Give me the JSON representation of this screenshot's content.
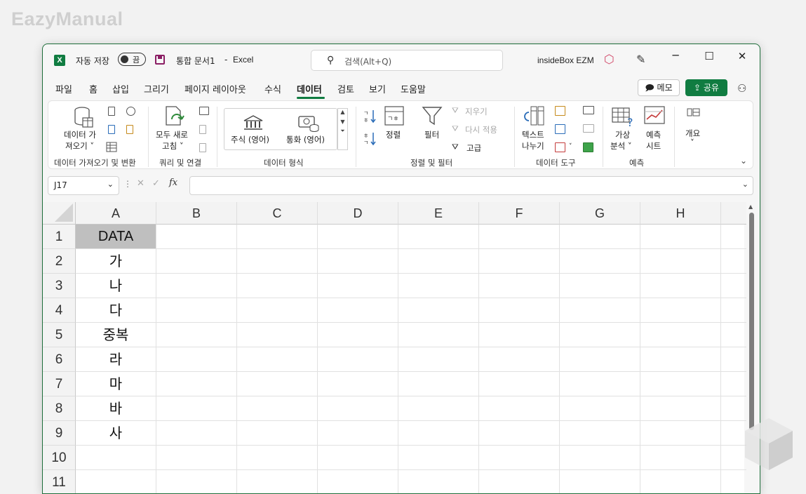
{
  "watermark": "EazyManual",
  "titlebar": {
    "autosave_label": "자동 저장",
    "autosave_state": "끔",
    "doc_title": "통합 문서1",
    "separator": "-",
    "app_name": "Excel",
    "search_placeholder": "검색(Alt+Q)",
    "user_name": "insideBox EZM"
  },
  "menu": {
    "tabs": [
      "파일",
      "홈",
      "삽입",
      "그리기",
      "페이지 레이아웃",
      "수식",
      "데이터",
      "검토",
      "보기",
      "도움말"
    ],
    "active": "데이터",
    "memo_label": "메모",
    "share_label": "공유"
  },
  "ribbon": {
    "get_data": {
      "label1": "데이터 가",
      "label2": "져오기 ˅",
      "group": "데이터 가져오기 및 변환"
    },
    "queries": {
      "refresh1": "모두 새로",
      "refresh2": "고침 ˅",
      "group": "쿼리 및 연결"
    },
    "datatypes": {
      "stocks": "주식 (영어)",
      "currency": "통화 (영어)",
      "group": "데이터 형식"
    },
    "sortfilter": {
      "sort": "정렬",
      "filter": "필터",
      "clear": "지우기",
      "reapply": "다시 적용",
      "advanced": "고급",
      "group": "정렬 및 필터"
    },
    "tools": {
      "text1": "텍스트",
      "text2": "나누기",
      "group": "데이터 도구"
    },
    "forecast": {
      "whatif1": "가상",
      "whatif2": "분석 ˅",
      "sheet1": "예측",
      "sheet2": "시트",
      "group": "예측"
    },
    "outline": {
      "label": "개요",
      "dropdown": "˅"
    }
  },
  "formula_bar": {
    "namebox": "J17",
    "fx": "fx",
    "value": ""
  },
  "grid": {
    "columns": [
      "A",
      "B",
      "C",
      "D",
      "E",
      "F",
      "G",
      "H"
    ],
    "rows": [
      "1",
      "2",
      "3",
      "4",
      "5",
      "6",
      "7",
      "8",
      "9",
      "10",
      "11"
    ],
    "column_a_values": [
      "DATA",
      "가",
      "나",
      "다",
      "중복",
      "라",
      "마",
      "바",
      "사",
      "",
      ""
    ]
  },
  "colors": {
    "accent": "#107c41",
    "header_fill": "#bfbfbf"
  }
}
